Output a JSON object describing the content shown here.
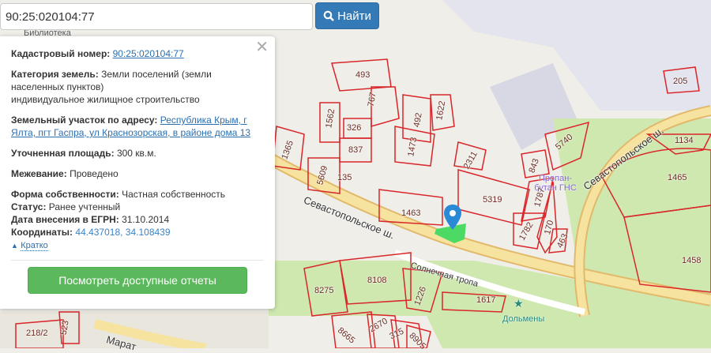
{
  "search": {
    "value": "90:25:020104:77",
    "button_label": "Найти",
    "button_icon": "search-icon"
  },
  "card": {
    "cadastral_label": "Кадастровый номер:",
    "cadastral_value": "90:25:020104:77",
    "category_label": "Категория земель:",
    "category_value": "Земли поселений (земли населенных пунктов)",
    "category_use": "индивидуальное жилищное строительство",
    "address_label": "Земельный участок по адресу:",
    "address_value": "Республика Крым, г Ялта, пгт Гаспра, ул Краснозорская, в районе дома 13",
    "area_label": "Уточненная площадь:",
    "area_value": "300 кв.м.",
    "survey_label": "Межевание:",
    "survey_value": "Проведено",
    "ownership_label": "Форма собственности:",
    "ownership_value": "Частная собственность",
    "status_label": "Статус:",
    "status_value": "Ранее учтенный",
    "date_label": "Дата внесения в ЕГРН:",
    "date_value": "31.10.2014",
    "coords_label": "Координаты:",
    "coords_value": "44.437018, 34.108439",
    "brief_label": "Кратко",
    "reports_button": "Посмотреть доступные отчеты",
    "close_icon": "close-icon"
  },
  "map": {
    "roads": [
      "Севастопольское ш.",
      "Севастопольское ш.",
      "Солнечная тропа",
      "Марат"
    ],
    "pois": [
      "Пропан-бутан ГНС",
      "Дольмены",
      "Библиотека"
    ],
    "parcels": [
      "493",
      "205",
      "767",
      "492",
      "1622",
      "1562",
      "326",
      "837",
      "1473",
      "1365",
      "5609",
      "135",
      "2311",
      "5740",
      "843",
      "1134",
      "5319",
      "1787",
      "1465",
      "1463",
      "170",
      "1782",
      "463",
      "1458",
      "8108",
      "8275",
      "1226",
      "1617",
      "2670",
      "315",
      "8665",
      "8905",
      "218/2",
      "523"
    ],
    "colors": {
      "parcel": "#d9262a",
      "green": "#cfe8b0",
      "road": "#f6e3a0",
      "selected": "#4cd964",
      "marker": "#2b8ad6"
    }
  }
}
